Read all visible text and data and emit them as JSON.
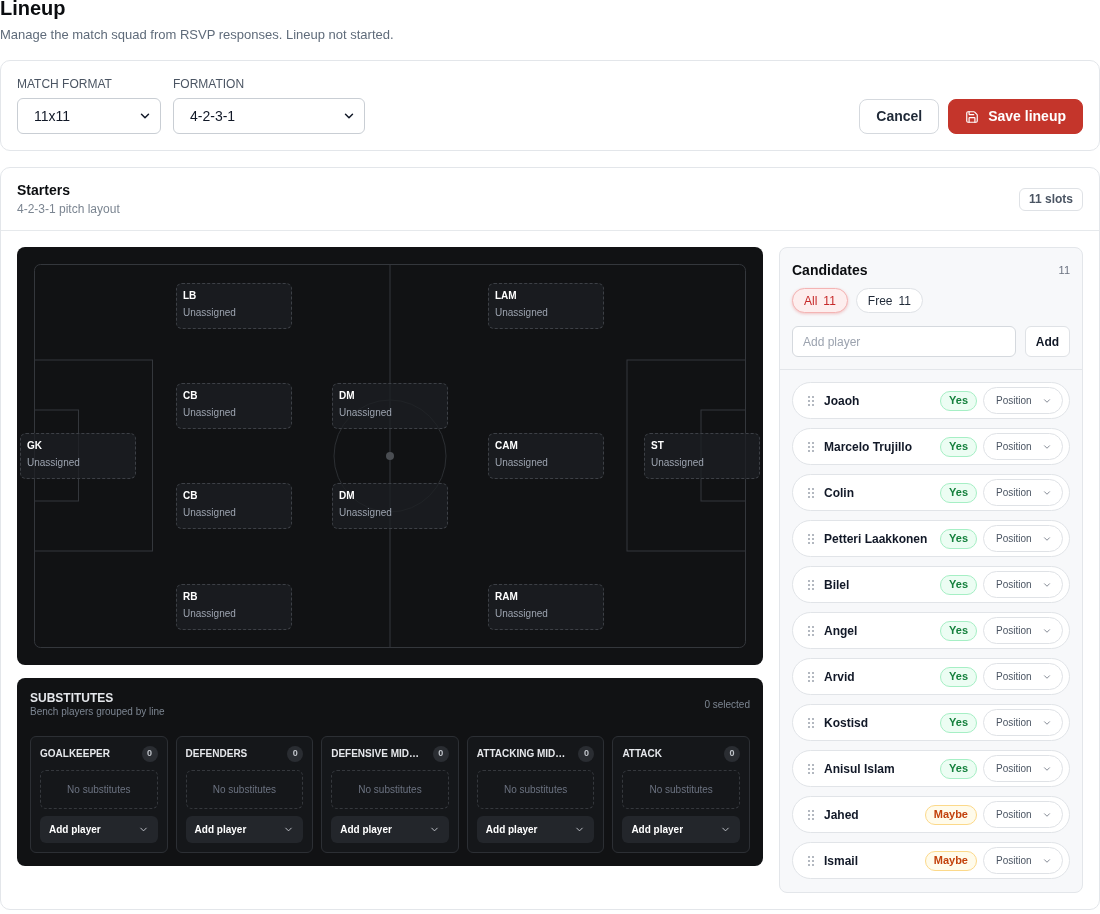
{
  "page": {
    "title": "Lineup",
    "subtitle": "Manage the match squad from RSVP responses. Lineup not started."
  },
  "settings": {
    "fields": [
      {
        "label": "MATCH FORMAT",
        "value": "11x11"
      },
      {
        "label": "FORMATION",
        "value": "4-2-3-1"
      }
    ],
    "buttons": [
      {
        "label": "Cancel",
        "kind": "secondary"
      },
      {
        "label": "Save lineup",
        "kind": "primary"
      }
    ]
  },
  "starters": {
    "title": "Starters",
    "subtitle": "4-2-3-1 pitch layout",
    "badge": "11 slots",
    "slots": [
      {
        "position": "GK",
        "player": "Unassigned"
      },
      {
        "position": "LB",
        "player": "Unassigned"
      },
      {
        "position": "CB",
        "player": "Unassigned"
      },
      {
        "position": "CB",
        "player": "Unassigned"
      },
      {
        "position": "RB",
        "player": "Unassigned"
      },
      {
        "position": "DM",
        "player": "Unassigned"
      },
      {
        "position": "DM",
        "player": "Unassigned"
      },
      {
        "position": "LAM",
        "player": "Unassigned"
      },
      {
        "position": "CAM",
        "player": "Unassigned"
      },
      {
        "position": "RAM",
        "player": "Unassigned"
      },
      {
        "position": "ST",
        "player": "Unassigned"
      }
    ]
  },
  "substitutes": {
    "title": "SUBSTITUTES",
    "subtitle": "Bench players grouped by line",
    "selected_count": "0 selected",
    "groups": [
      {
        "name": "GOALKEEPER",
        "count": "0",
        "empty_text": "No substitutes",
        "add_label": "Add player"
      },
      {
        "name": "DEFENDERS",
        "count": "0",
        "empty_text": "No substitutes",
        "add_label": "Add player"
      },
      {
        "name": "DEFENSIVE MID…",
        "count": "0",
        "empty_text": "No substitutes",
        "add_label": "Add player"
      },
      {
        "name": "ATTACKING MID…",
        "count": "0",
        "empty_text": "No substitutes",
        "add_label": "Add player"
      },
      {
        "name": "ATTACK",
        "count": "0",
        "empty_text": "No substitutes",
        "add_label": "Add player"
      }
    ]
  },
  "candidates": {
    "title": "Candidates",
    "count": "11",
    "filters": [
      {
        "label": "All",
        "count": "11",
        "selected": true
      },
      {
        "label": "Free",
        "count": "11",
        "selected": false
      }
    ],
    "add_field": {
      "placeholder": "Add player"
    },
    "add_button": "Add",
    "players": [
      {
        "name": "Joaoh",
        "rsvp": {
          "label": "Yes",
          "kind": "yes"
        },
        "position_select": "Position"
      },
      {
        "name": "Marcelo Trujillo",
        "rsvp": {
          "label": "Yes",
          "kind": "yes"
        },
        "position_select": "Position"
      },
      {
        "name": "Colin",
        "rsvp": {
          "label": "Yes",
          "kind": "yes"
        },
        "position_select": "Position"
      },
      {
        "name": "Petteri Laakkonen",
        "rsvp": {
          "label": "Yes",
          "kind": "yes"
        },
        "position_select": "Position"
      },
      {
        "name": "Bilel",
        "rsvp": {
          "label": "Yes",
          "kind": "yes"
        },
        "position_select": "Position"
      },
      {
        "name": "Angel",
        "rsvp": {
          "label": "Yes",
          "kind": "yes"
        },
        "position_select": "Position"
      },
      {
        "name": "Arvid",
        "rsvp": {
          "label": "Yes",
          "kind": "yes"
        },
        "position_select": "Position"
      },
      {
        "name": "Kostisd",
        "rsvp": {
          "label": "Yes",
          "kind": "yes"
        },
        "position_select": "Position"
      },
      {
        "name": "Anisul Islam",
        "rsvp": {
          "label": "Yes",
          "kind": "yes"
        },
        "position_select": "Position"
      },
      {
        "name": "Jahed",
        "rsvp": {
          "label": "Maybe",
          "kind": "maybe"
        },
        "position_select": "Position"
      },
      {
        "name": "Ismail",
        "rsvp": {
          "label": "Maybe",
          "kind": "maybe"
        },
        "position_select": "Position"
      }
    ]
  }
}
